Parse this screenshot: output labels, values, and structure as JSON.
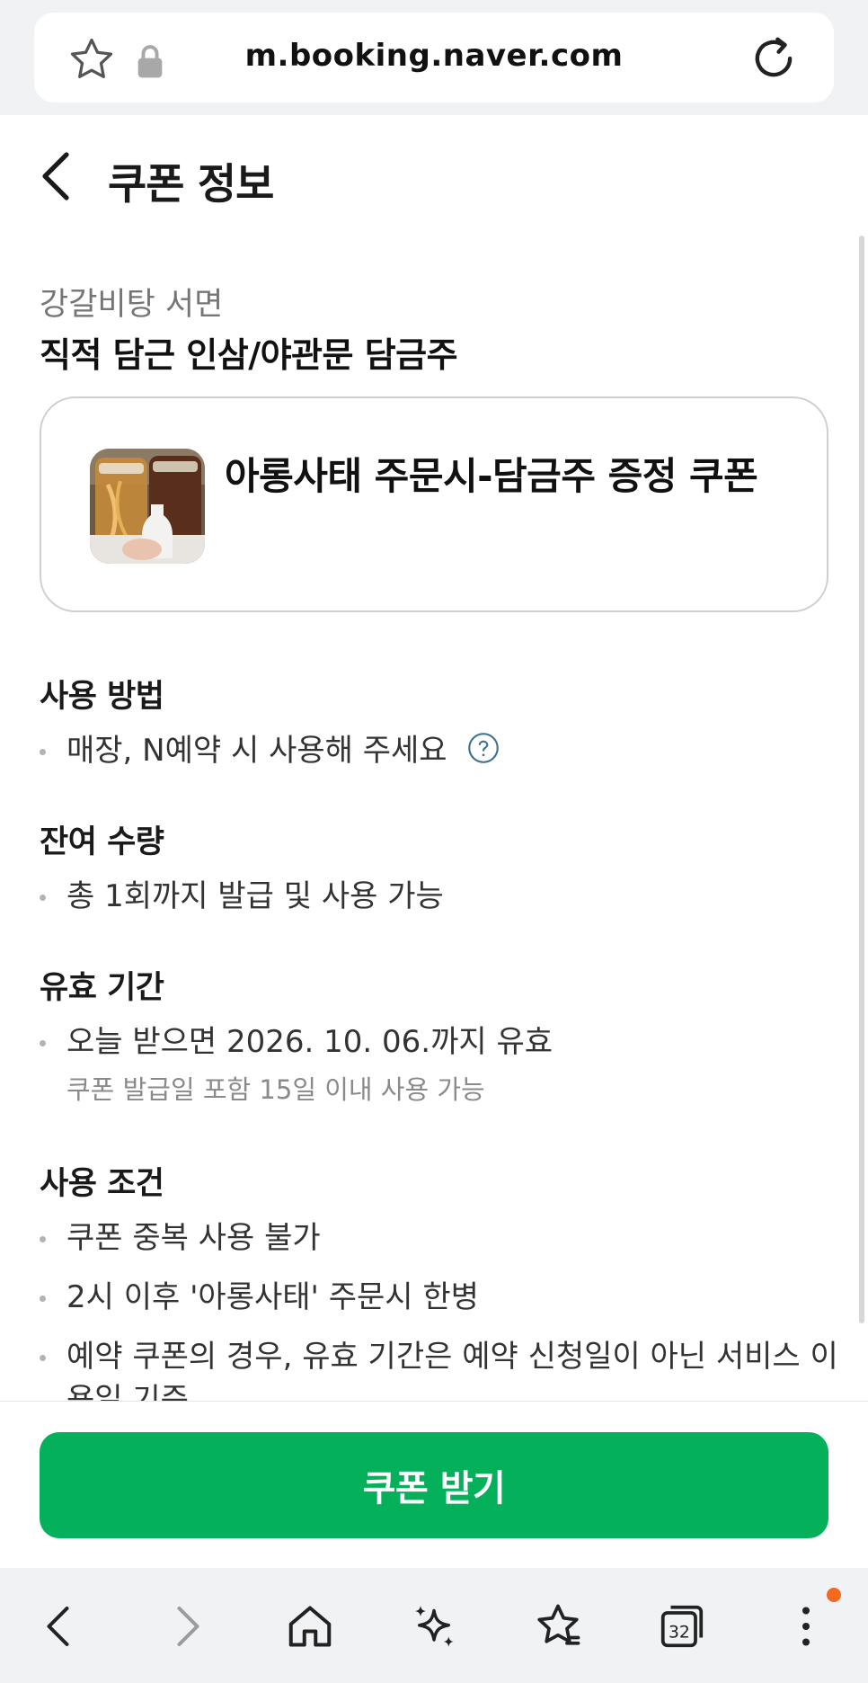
{
  "browser": {
    "url": "m.booking.naver.com",
    "tabs_count": "32",
    "icons": [
      "star-icon",
      "lock-icon",
      "reload-icon",
      "back-arrow-icon",
      "forward-arrow-icon",
      "home-icon",
      "sparkle-icon",
      "bookmarks-icon",
      "tabs-icon",
      "more-icon"
    ]
  },
  "header": {
    "title": "쿠폰 정보"
  },
  "store": {
    "name": "강갈비탕 서면",
    "coupon_name": "직적 담근 인삼/야관문 담금주"
  },
  "coupon_card": {
    "title": "아롱사태 주문시-담금주 증정 쿠폰"
  },
  "usage": {
    "title": "사용 방법",
    "items": [
      "매장, N예약 시 사용해 주세요"
    ]
  },
  "remaining": {
    "title": "잔여 수량",
    "items": [
      "총 1회까지 발급 및 사용 가능"
    ]
  },
  "validity": {
    "title": "유효 기간",
    "items": [
      "오늘 받으면 2026. 10. 06.까지 유효"
    ],
    "note": "쿠폰 발급일 포함 15일 이내 사용 가능"
  },
  "conditions": {
    "title": "사용 조건",
    "items": [
      "쿠폰 중복 사용 불가",
      "2시 이후 '아롱사태' 주문시 한병",
      "예약 쿠폰의 경우, 유효 기간은 예약 신청일이 아닌 서비스 이용일 기준"
    ]
  },
  "cta": {
    "label": "쿠폰 받기",
    "color": "#04b05a"
  }
}
